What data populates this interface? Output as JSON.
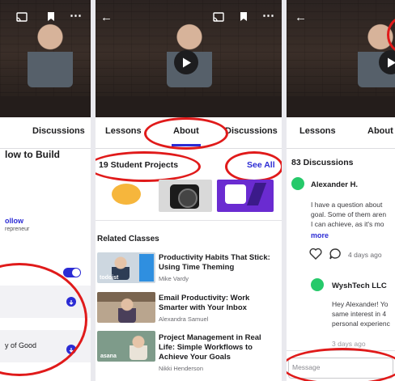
{
  "panel1": {
    "tab_discussions": "Discussions",
    "title_fragment": "low to Build",
    "follow_label": "ollow",
    "follow_sub": "repreneur",
    "row_label": "y of Good"
  },
  "panel2": {
    "tabs": [
      "Lessons",
      "About",
      "Discussions"
    ],
    "projects_heading": "19 Student Projects",
    "see_all": "See All",
    "related_heading": "Related Classes",
    "classes": [
      {
        "title_line1": "Productivity Habits That Stick:",
        "title_line2": "Using Time Theming",
        "author": "Mike Vardy",
        "badge": "todoist"
      },
      {
        "title_line1": "Email Productivity: Work",
        "title_line2": "Smarter with Your Inbox",
        "author": "Alexandra Samuel"
      },
      {
        "title_line1": "Project Management in Real",
        "title_line2": "Life: Simple Workflows to",
        "title_line3": "Achieve Your Goals",
        "author": "Nikki Henderson",
        "badge": "asana"
      }
    ]
  },
  "panel3": {
    "tabs": [
      "Lessons",
      "About"
    ],
    "discussions_count": "83 Discussions",
    "comment1_author": "Alexander H.",
    "comment1_lines": [
      "I have a question about",
      "goal. Some of them aren",
      "I can achieve, as it's mo"
    ],
    "more_label": "more",
    "time_ago": "4 days ago",
    "comment2_author": "WyshTech LLC",
    "comment2_lines": [
      "Hey Alexander! Yo",
      "same interest in 4",
      "personal experienc"
    ],
    "time_ago2": "3 days ago",
    "message_placeholder": "Message"
  },
  "colors": {
    "accent": "#2b2bd4",
    "annotation": "#e01a1a",
    "avatar": "#26c96a"
  }
}
